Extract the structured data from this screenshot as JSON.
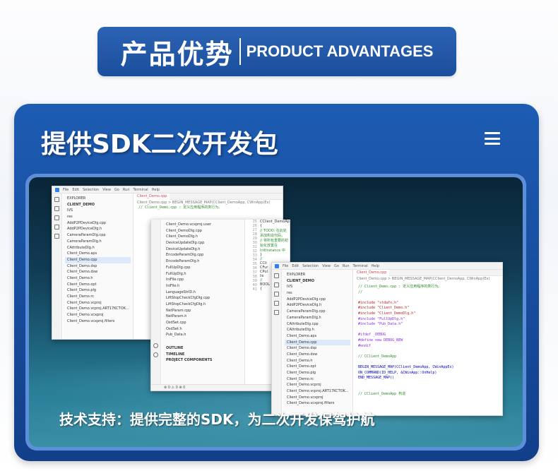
{
  "header": {
    "title_cn": "产品优势",
    "title_en": "PRODUCT ADVANTAGES"
  },
  "card": {
    "title": "提供SDK二次开发包",
    "caption": "技术支持：提供完整的SDK，为二次开发保驾护航"
  },
  "win1": {
    "menu": [
      "File",
      "Edit",
      "Selection",
      "View",
      "Go",
      "Run",
      "Terminal",
      "Help"
    ],
    "explorer": "EXPLORER",
    "project": "CLIENT_DEMO",
    "files": [
      "IVS",
      "res",
      "AddP2PDeviceDlg.cpp",
      "AddP2PDeviceDlg.h",
      "CameraParamDlg.cpp",
      "CameraParamDlg.h",
      "CAttributeDlg.h",
      "Client_Demo.aps",
      "Client_Demo.cpp",
      "Client_Demo.dsp",
      "Client_Demo.dsw",
      "Client_Demo.h",
      "Client_Demo.opt",
      "Client_Demo.plg",
      "Client_Demo.rc",
      "Client_Demo.vcproj",
      "Client_Demo.vcproj.ART17KCTOK...",
      "Client_Demo.vcxproj",
      "Client_Demo.vcxproj.filters"
    ],
    "tab": "Client_Demo.cpp",
    "breadcrumb": "Client_Demo.cpp > BEGIN_MESSAGE_MAP(CClient_DemoApp, CWinApp)Ex)",
    "comment": "// Client_Demo.cpp : 定义应用程序的类行为。"
  },
  "win2": {
    "files": [
      "Client_Demo.vcxproj.user",
      "Client_DemoDlg.cpp",
      "Client_DemoDlg.h",
      "DeviceUpdateDlg.cpp",
      "DeviceUpdateDlg.h",
      "EncodeParamDlg.cpp",
      "EncodeParamDlg.h",
      "FullUpDlg.cpp",
      "FullUpDlg.h",
      "IniFile.cpp",
      "IniFile.h",
      "LanguageStrID.h",
      "LiftStopCheckCfgDlg.cpp",
      "LiftStopCheckCfgDlg.h",
      "NetParam.cpp",
      "NetParam.h",
      "OsdSet.cpp",
      "OsdSet.h",
      "Pub_Data.h"
    ],
    "sections": [
      "OUTLINE",
      "TIMELINE",
      "PROJECT COMPONENTS"
    ],
    "line_numbers": [
      "25",
      "26",
      "27",
      "28",
      "29",
      "30",
      "31",
      "32",
      "33",
      "34",
      "35",
      "36",
      "37",
      "38",
      "39",
      "40",
      "41"
    ],
    "code": [
      "CClient_DemoApp::CClient_DemoApp()",
      "{",
      "  // TODO: 在此处添加构造代码，",
      "  // 将所有重要的初始化放置在 InitInstance 中",
      "}",
      "",
      "//",
      "",
      "CCli",
      "CFur",
      "CPul",
      "lis",
      "",
      "//",
      "",
      "BOOL",
      "{"
    ],
    "status": "⊗ 0 ⚠ 0  ⊗ 0"
  },
  "win3": {
    "menu": [
      "File",
      "Edit",
      "Selection",
      "View",
      "Go",
      "Run",
      "Terminal",
      "Help"
    ],
    "explorer": "EXPLORER",
    "project": "CLIENT_DEMO",
    "files": [
      "IVS",
      "res",
      "AddP2PDeviceDlg.cpp",
      "AddP2PDeviceDlg.h",
      "CameraParamDlg.cpp",
      "CameraParamDlg.h",
      "CAttributeDlg.cpp",
      "CAttributeDlg.h",
      "Client_Demo.aps",
      "Client_Demo.cpp",
      "Client_Demo.dsp",
      "Client_Demo.dsw",
      "Client_Demo.h",
      "Client_Demo.opt",
      "Client_Demo.plg",
      "Client_Demo.rc",
      "Client_Demo.vcproj",
      "Client_Demo.vcproj.ART17KCTOK...",
      "Client_Demo.vcxproj",
      "Client_Demo.vcxproj.filters"
    ],
    "tab": "Client_Demo.cpp",
    "breadcrumb": "Client_Demo.cpp > BEGIN_MESSAGE_MAP(CClient_DemoApp, CWinApp)Ex)",
    "code": [
      {
        "t": "// Client_Demo.cpp : 定义应用程序的类行为。",
        "c": "green"
      },
      {
        "t": "//",
        "c": "green"
      },
      {
        "t": "",
        "c": ""
      },
      {
        "t": "#include \"stdafx.h\"",
        "c": "red"
      },
      {
        "t": "#include \"Client_Demo.h\"",
        "c": "red"
      },
      {
        "t": "#include \"Client_DemoDlg.h\"",
        "c": "red"
      },
      {
        "t": "#include \"FullUpDlg.h\"",
        "c": "purple"
      },
      {
        "t": "#include \"Pub_Data.h\"",
        "c": "purple"
      },
      {
        "t": "",
        "c": ""
      },
      {
        "t": "#ifdef _DEBUG",
        "c": "purple"
      },
      {
        "t": "#define new DEBUG_NEW",
        "c": "purple"
      },
      {
        "t": "#endif",
        "c": "purple"
      },
      {
        "t": "",
        "c": ""
      },
      {
        "t": "// CClient_DemoApp",
        "c": "green"
      },
      {
        "t": "",
        "c": ""
      },
      {
        "t": "BEGIN_MESSAGE_MAP(CClient_DemoApp, CWinAppEx)",
        "c": "blue"
      },
      {
        "t": "    ON_COMMAND(ID_HELP, &CWinApp::OnHelp)",
        "c": "blue"
      },
      {
        "t": "END_MESSAGE_MAP()",
        "c": "blue"
      },
      {
        "t": "",
        "c": ""
      },
      {
        "t": "",
        "c": ""
      },
      {
        "t": "// CClient_DemoApp 构造",
        "c": "green"
      }
    ]
  }
}
